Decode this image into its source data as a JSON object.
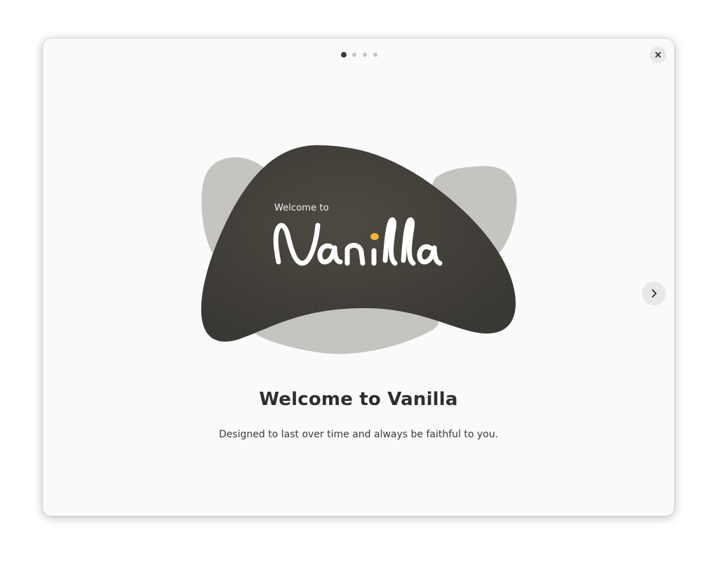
{
  "pager": {
    "total_pages": 4,
    "current_page": 1
  },
  "hero": {
    "small_text": "Welcome to",
    "logo_text": "Vanilla",
    "accent_color": "#f5b73b",
    "blob_dark_color": "#3f3d38",
    "blob_light_color": "#c4c3c0"
  },
  "content": {
    "title": "Welcome to Vanilla",
    "subtitle": "Designed to last over time and always be faithful to you."
  },
  "icons": {
    "close": "close-icon",
    "next": "chevron-right-icon"
  }
}
